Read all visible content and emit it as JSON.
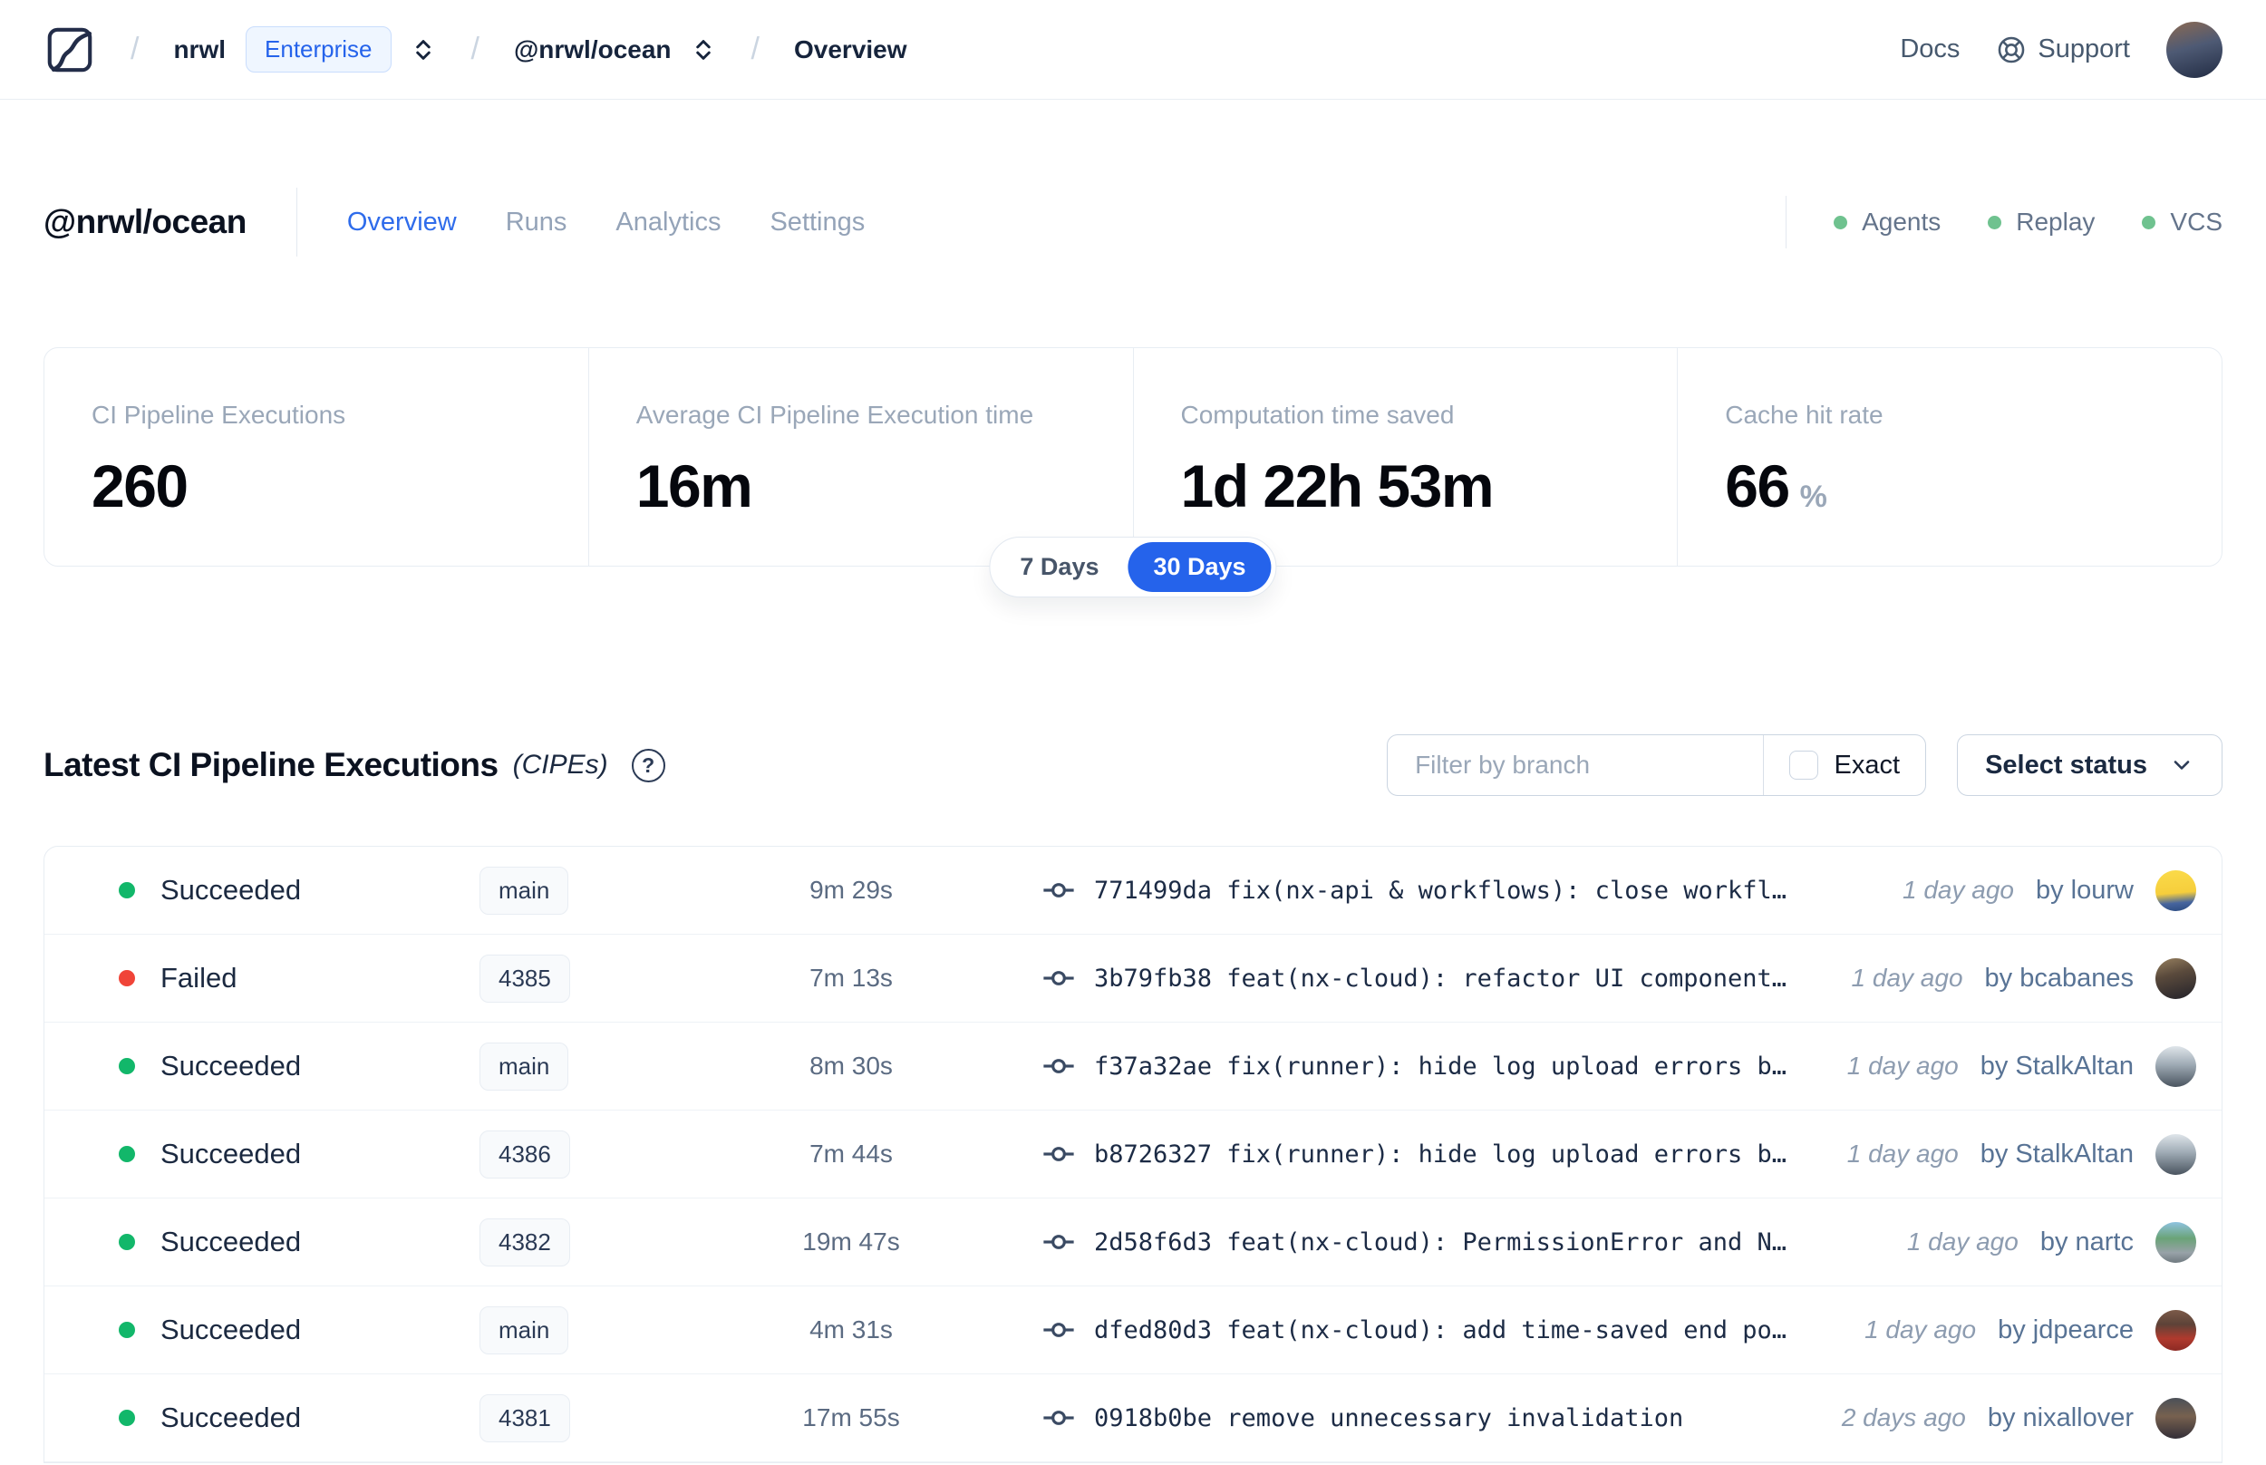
{
  "nav": {
    "logo": "nx-cloud-logo",
    "breadcrumb": {
      "org": "nrwl",
      "org_badge": "Enterprise",
      "workspace": "@nrwl/ocean",
      "page": "Overview"
    },
    "links": [
      {
        "label": "Docs"
      },
      {
        "label": "Support",
        "icon": "lifebuoy-icon"
      }
    ],
    "avatar_style": "background:linear-gradient(165deg,#8c6a52 0%,#4e5a74 45%,#222c44 100%)"
  },
  "header": {
    "title": "@nrwl/ocean",
    "tabs": [
      {
        "label": "Overview",
        "active": true
      },
      {
        "label": "Runs",
        "active": false
      },
      {
        "label": "Analytics",
        "active": false
      },
      {
        "label": "Settings",
        "active": false
      }
    ],
    "statuses": [
      {
        "label": "Agents"
      },
      {
        "label": "Replay"
      },
      {
        "label": "VCS"
      }
    ]
  },
  "stats": {
    "cards": [
      {
        "label": "CI Pipeline Executions",
        "value": "260"
      },
      {
        "label": "Average CI Pipeline Execution time",
        "value": "16m"
      },
      {
        "label": "Computation time saved",
        "value": "1d 22h 53m"
      },
      {
        "label": "Cache hit rate",
        "value": "66",
        "suffix": "%"
      }
    ],
    "range_toggle": {
      "options": [
        "7 Days",
        "30 Days"
      ],
      "selected": "30 Days"
    }
  },
  "cipes": {
    "title": "Latest CI Pipeline Executions",
    "title_suffix": "(CIPEs)",
    "help_glyph": "?",
    "filter_placeholder": "Filter by branch",
    "exact_label": "Exact",
    "status_button": "Select status",
    "rows": [
      {
        "status": "Succeeded",
        "status_color": "green",
        "branch": "main",
        "duration": "9m 29s",
        "commit": "771499da fix(nx-api & workflows): close workfl…",
        "time": "1 day ago",
        "author": "by lourw",
        "avatar_style": "background:linear-gradient(175deg,#fbdb4a 0%,#f6ce3c 55%,#47659e 78%,#2a4a80 100%)"
      },
      {
        "status": "Failed",
        "status_color": "red",
        "branch": "4385",
        "duration": "7m 13s",
        "commit": "3b79fb38 feat(nx-cloud): refactor UI component…",
        "time": "1 day ago",
        "author": "by bcabanes",
        "avatar_style": "background:linear-gradient(165deg,#97805f 0%,#5a4a3c 40%,#23222a 100%)"
      },
      {
        "status": "Succeeded",
        "status_color": "green",
        "branch": "main",
        "duration": "8m 30s",
        "commit": "f37a32ae fix(runner): hide log upload errors b…",
        "time": "1 day ago",
        "author": "by StalkAltan",
        "avatar_style": "background:linear-gradient(180deg,#dfe5ea 0%,#9fabb5 45%,#4a545f 100%)"
      },
      {
        "status": "Succeeded",
        "status_color": "green",
        "branch": "4386",
        "duration": "7m 44s",
        "commit": "b8726327 fix(runner): hide log upload errors b…",
        "time": "1 day ago",
        "author": "by StalkAltan",
        "avatar_style": "background:linear-gradient(180deg,#dfe5ea 0%,#9fabb5 45%,#4a545f 100%)"
      },
      {
        "status": "Succeeded",
        "status_color": "green",
        "branch": "4382",
        "duration": "19m 47s",
        "commit": "2d58f6d3 feat(nx-cloud): PermissionError and N…",
        "time": "1 day ago",
        "author": "by nartc",
        "avatar_style": "background:linear-gradient(180deg,#8fc3e0 0%,#6aa377 40%,#98a2a8 75%,#707a80 100%)"
      },
      {
        "status": "Succeeded",
        "status_color": "green",
        "branch": "main",
        "duration": "4m 31s",
        "commit": "dfed80d3 feat(nx-cloud): add time-saved end po…",
        "time": "1 day ago",
        "author": "by jdpearce",
        "avatar_style": "background:linear-gradient(180deg,#7c5a49 0%,#5d4338 35%,#b03a2e 70%,#8c2a24 100%)"
      },
      {
        "status": "Succeeded",
        "status_color": "green",
        "branch": "4381",
        "duration": "17m 55s",
        "commit": "0918b0be remove unnecessary invalidation",
        "time": "2 days ago",
        "author": "by nixallover",
        "avatar_style": "background:linear-gradient(180deg,#4b5058 0%,#77614f 45%,#332f38 100%)"
      }
    ]
  },
  "colors": {
    "accent_blue": "#2563eb",
    "tab_active_blue": "#2f6ceb",
    "success_green": "#12b76a",
    "failed_red": "#f04438",
    "header_dot_green": "#6fc28f",
    "border": "#e8edf3",
    "muted_text": "#94a3b8"
  }
}
